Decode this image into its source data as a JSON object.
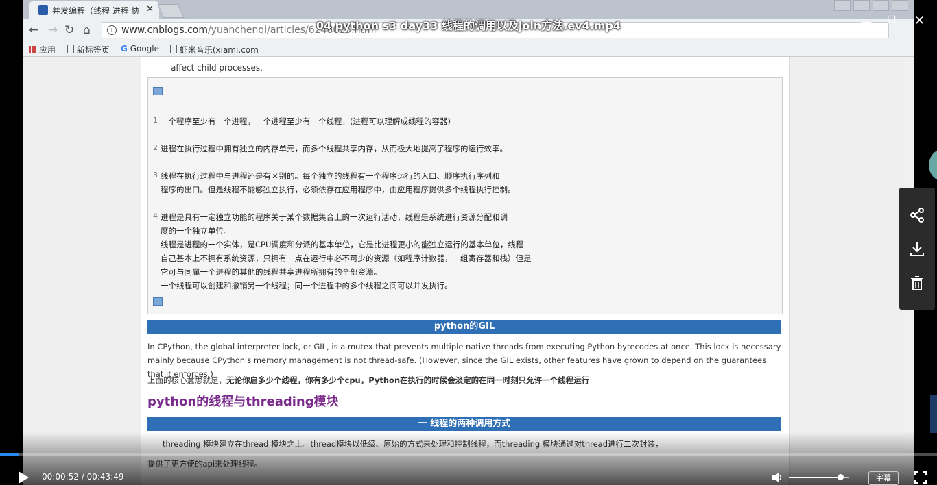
{
  "player": {
    "title": "04 python s3 day33  线程的调用以及join方法.ev4.mp4",
    "current_time": "00:00:52",
    "time_separator": " / ",
    "total_time": "00:43:49",
    "progress": 0.0198,
    "volume": 0.85,
    "subtitle_label": "字幕",
    "side_actions": [
      "share-icon",
      "download-icon",
      "delete-icon"
    ],
    "accent_color": "#2a8bf2"
  },
  "browser": {
    "tab_title": "并发编程（线程 进程 协",
    "url_host": "www.cnblogs.com",
    "url_path": "/yuanchenqi/articles/6248025.html",
    "bookmarks": [
      "应用",
      "新标签页",
      "Google",
      "虾米音乐(xiami.com"
    ]
  },
  "article": {
    "intro_tail": "affect child processes.",
    "code_lines": [
      {
        "num": "1",
        "lines": [
          "一个程序至少有一个进程，一个进程至少有一个线程，(进程可以理解成线程的容器)"
        ]
      },
      {
        "num": "2",
        "lines": [
          "进程在执行过程中拥有独立的内存单元，而多个线程共享内存，从而极大地提高了程序的运行效率。"
        ]
      },
      {
        "num": "3",
        "lines": [
          "线程在执行过程中与进程还是有区别的。每个独立的线程有一个程序运行的入口、顺序执行序列和",
          "程序的出口。但是线程不能够独立执行，必须依存在应用程序中，由应用程序提供多个线程执行控制。"
        ]
      },
      {
        "num": "4",
        "lines": [
          "进程是具有一定独立功能的程序关于某个数据集合上的一次运行活动，线程是系统进行资源分配和调",
          "度的一个独立单位。",
          "线程是进程的一个实体，是CPU调度和分派的基本单位，它是比进程更小的能独立运行的基本单位，线程",
          "自己基本上不拥有系统资源，只拥有一点在运行中必不可少的资源（如程序计数器，一组寄存器和栈）但是",
          "它可与同属一个进程的其他的线程共享进程所拥有的全部资源。",
          "一个线程可以创建和撤销另一个线程；同一个进程中的多个线程之间可以并发执行。"
        ]
      }
    ],
    "gil_heading": "python的GIL",
    "gil_para": "In CPython, the global interpreter lock, or GIL, is a mutex that prevents multiple native threads from executing Python bytecodes at once. This lock is necessary mainly because CPython's memory management is not thread-safe. (However, since the GIL exists, other features have grown to depend on the guarantees that it enforces.)",
    "gil_summary_prefix": "上面的核心意思就是，",
    "gil_summary_bold": "无论你启多少个线程，你有多少个cpu，Python在执行的时候会淡定的在同一时刻只允许一个线程运行",
    "threading_heading": "python的线程与threading模块",
    "call_heading": "一 线程的两种调用方式",
    "threading_para": "threading 模块建立在thread 模块之上。thread模块以低级、原始的方式来处理和控制线程，而threading 模块通过对thread进行二次封装，",
    "threading_para2": "提供了更方便的api来处理线程。"
  }
}
